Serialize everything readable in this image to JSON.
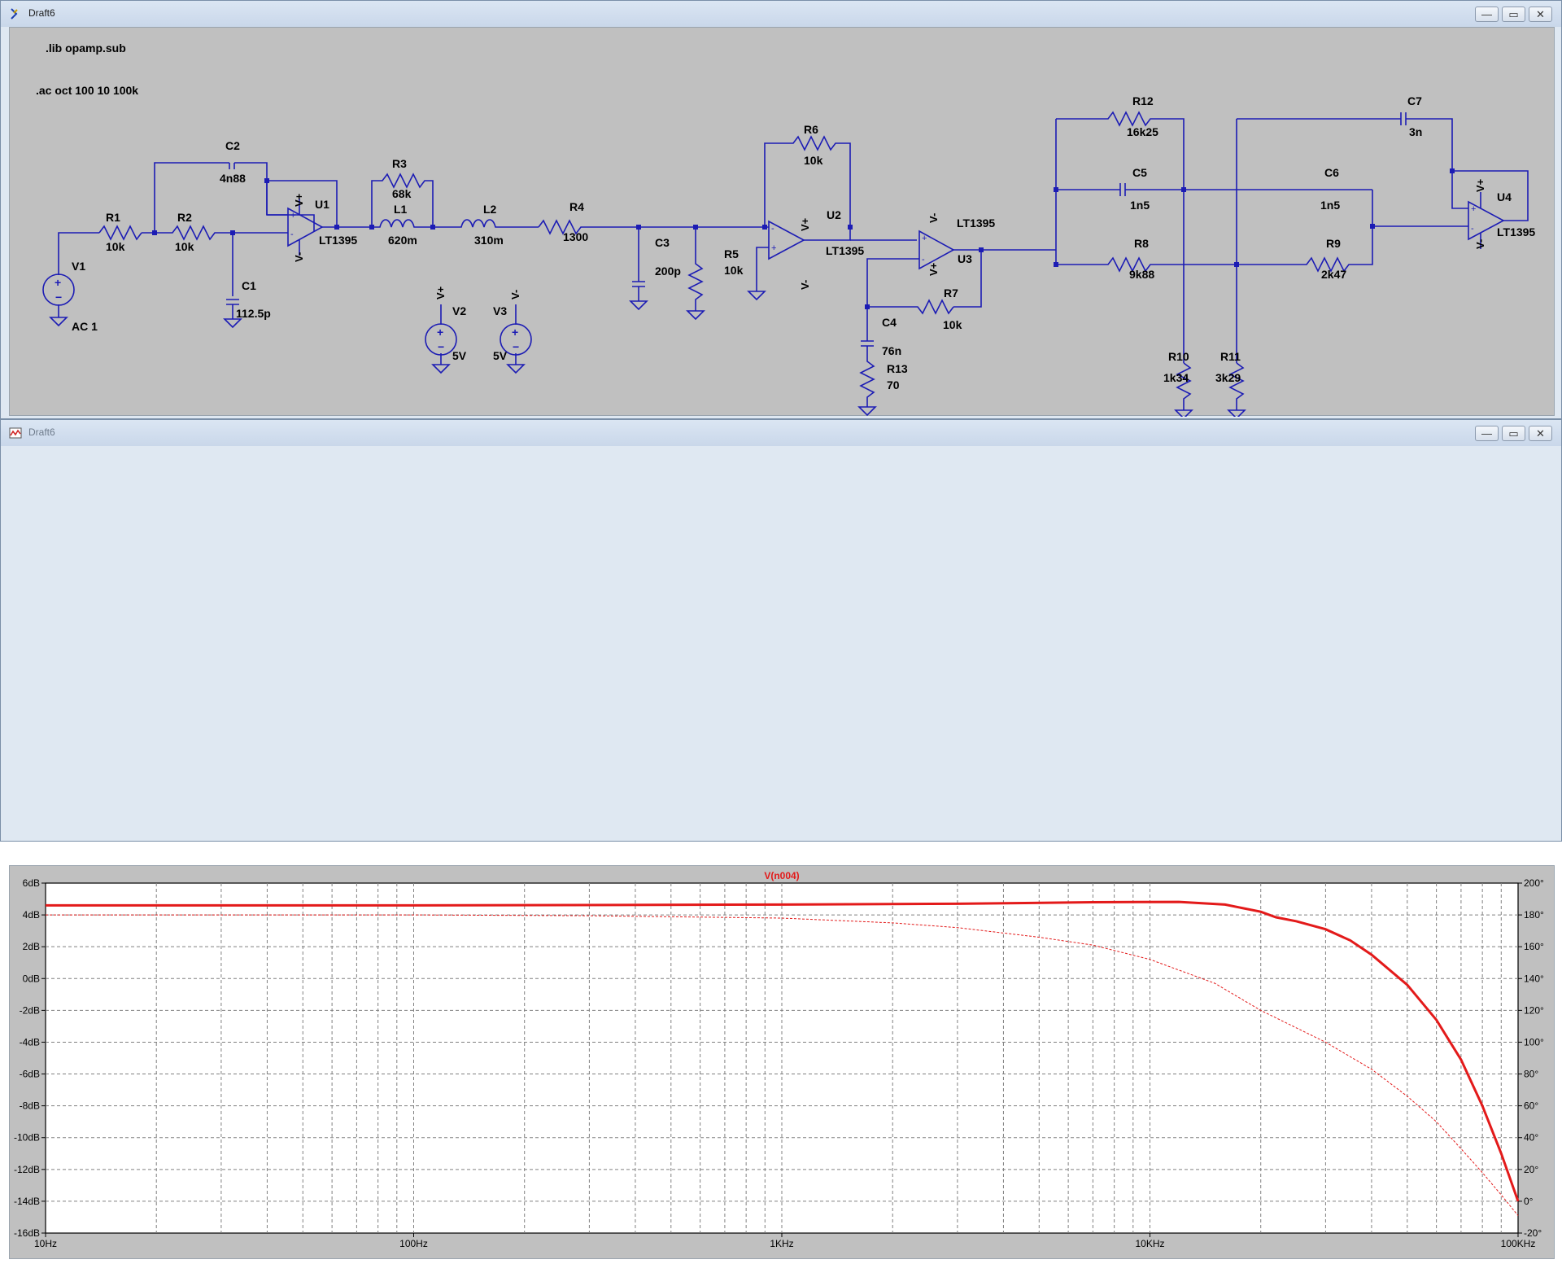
{
  "schematic_window": {
    "title": "Draft6"
  },
  "plot_window": {
    "title": "Draft6"
  },
  "window_buttons": {
    "minimize": "—",
    "restore": "▭",
    "close": "✕"
  },
  "colors": {
    "wire": "#1c1cb4",
    "trace": "#e31a1a",
    "schematic_bg": "#c0c0c0",
    "plot_bg": "#ffffff"
  },
  "directives": {
    "lib": ".lib opamp.sub",
    "ac": ".ac oct 100 10 100k"
  },
  "components": {
    "r1": {
      "ref": "R1",
      "value": "10k"
    },
    "r2": {
      "ref": "R2",
      "value": "10k"
    },
    "r3": {
      "ref": "R3",
      "value": "68k"
    },
    "r4": {
      "ref": "R4",
      "value": "1300"
    },
    "r5": {
      "ref": "R5",
      "value": "10k"
    },
    "r6": {
      "ref": "R6",
      "value": "10k"
    },
    "r7": {
      "ref": "R7",
      "value": "10k"
    },
    "r8": {
      "ref": "R8",
      "value": "9k88"
    },
    "r9": {
      "ref": "R9",
      "value": "2k47"
    },
    "r10": {
      "ref": "R10",
      "value": "1k34"
    },
    "r11": {
      "ref": "R11",
      "value": "3k29"
    },
    "r12": {
      "ref": "R12",
      "value": "16k25"
    },
    "r13": {
      "ref": "R13",
      "value": "70"
    },
    "c1": {
      "ref": "C1",
      "value": "112.5p"
    },
    "c2": {
      "ref": "C2",
      "value": "4n88"
    },
    "c3": {
      "ref": "C3",
      "value": "200p"
    },
    "c4": {
      "ref": "C4",
      "value": "76n"
    },
    "c5": {
      "ref": "C5",
      "value": "1n5"
    },
    "c6": {
      "ref": "C6",
      "value": "1n5"
    },
    "c7": {
      "ref": "C7",
      "value": "3n"
    },
    "l1": {
      "ref": "L1",
      "value": "620m"
    },
    "l2": {
      "ref": "L2",
      "value": "310m"
    },
    "v1": {
      "ref": "V1",
      "value": "AC 1"
    },
    "v2": {
      "ref": "V2",
      "value": "5V",
      "pin": "V+"
    },
    "v3": {
      "ref": "V3",
      "value": "5V",
      "pin": "V-"
    },
    "u1": {
      "ref": "U1",
      "model": "LT1395"
    },
    "u2": {
      "ref": "U2",
      "model": "LT1395"
    },
    "u3": {
      "ref": "U3",
      "model": "LT1395"
    },
    "u4": {
      "ref": "U4",
      "model": "LT1395"
    }
  },
  "opamp_pins": {
    "vplus": "V+",
    "vminus": "V-",
    "plus": "+",
    "minus": "-"
  },
  "chart_data": {
    "type": "line",
    "title": "V(n004)",
    "x_scale": "log",
    "xlim": [
      10,
      100000
    ],
    "x_ticks": [
      "10Hz",
      "100Hz",
      "1KHz",
      "10KHz",
      "100KHz"
    ],
    "y_left_ticks": [
      "6dB",
      "4dB",
      "2dB",
      "0dB",
      "-2dB",
      "-4dB",
      "-6dB",
      "-8dB",
      "-10dB",
      "-12dB",
      "-14dB",
      "-16dB"
    ],
    "y_right_ticks": [
      "200°",
      "180°",
      "160°",
      "140°",
      "120°",
      "100°",
      "80°",
      "60°",
      "40°",
      "20°",
      "0°",
      "-20°"
    ],
    "ylim_left": [
      -16,
      6
    ],
    "ylim_right": [
      -20,
      200
    ],
    "grid": true,
    "series": [
      {
        "axis": "left",
        "style": "solid",
        "points": [
          [
            10,
            4.6
          ],
          [
            100,
            4.6
          ],
          [
            1000,
            4.65
          ],
          [
            3000,
            4.7
          ],
          [
            7000,
            4.8
          ],
          [
            12000,
            4.82
          ],
          [
            16000,
            4.65
          ],
          [
            20000,
            4.2
          ],
          [
            22000,
            3.85
          ],
          [
            25000,
            3.6
          ],
          [
            30000,
            3.1
          ],
          [
            35000,
            2.4
          ],
          [
            40000,
            1.5
          ],
          [
            50000,
            -0.4
          ],
          [
            60000,
            -2.6
          ],
          [
            70000,
            -5.1
          ],
          [
            80000,
            -8.0
          ],
          [
            90000,
            -11.0
          ],
          [
            100000,
            -14.0
          ]
        ]
      },
      {
        "axis": "right",
        "style": "dashed",
        "points": [
          [
            10,
            180
          ],
          [
            100,
            180
          ],
          [
            300,
            179.5
          ],
          [
            1000,
            178
          ],
          [
            2000,
            175
          ],
          [
            3000,
            172
          ],
          [
            5000,
            166
          ],
          [
            7000,
            161
          ],
          [
            10000,
            152
          ],
          [
            15000,
            137
          ],
          [
            20000,
            120
          ],
          [
            30000,
            100
          ],
          [
            40000,
            83
          ],
          [
            50000,
            66
          ],
          [
            60000,
            50
          ],
          [
            70000,
            33
          ],
          [
            80000,
            18
          ],
          [
            90000,
            4
          ],
          [
            100000,
            -9
          ]
        ]
      }
    ]
  }
}
